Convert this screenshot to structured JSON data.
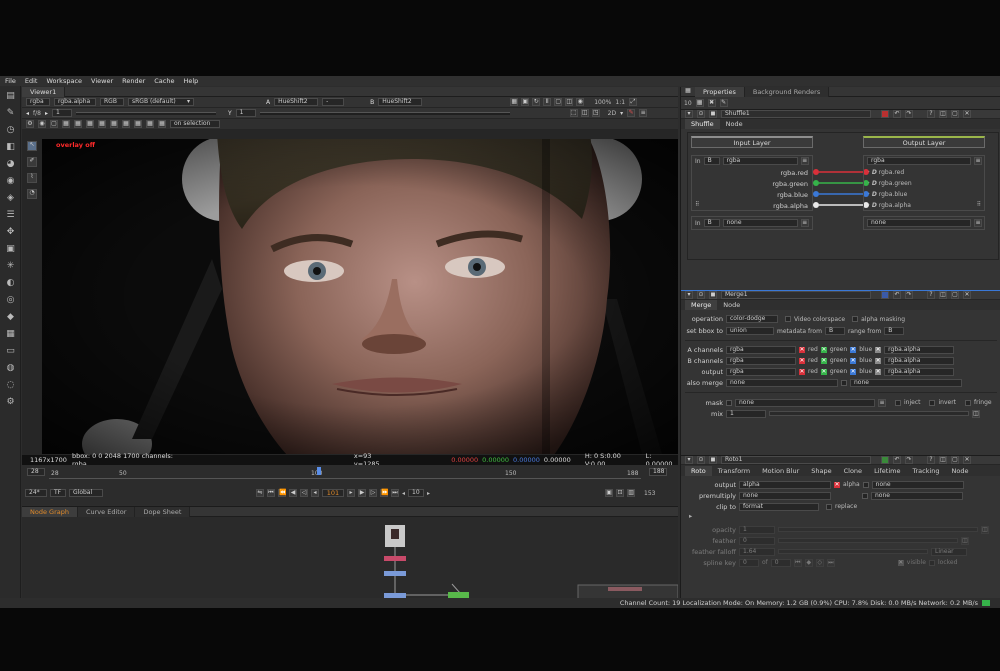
{
  "menu": [
    "File",
    "Edit",
    "Workspace",
    "Viewer",
    "Render",
    "Cache",
    "Help"
  ],
  "viewer": {
    "tab": "Viewer1",
    "channels": "rgba",
    "alpha": "rgba.alpha",
    "display": "RGB",
    "lut": "sRGB (default)",
    "input_a_label": "A",
    "input_a": "HueShift2",
    "input_b_label": "B",
    "input_b": "HueShift2",
    "zoom": "100%",
    "ratio": "1:1",
    "mode": "2D",
    "fstop": "f/8",
    "gain": "1",
    "gamma_label": "Y",
    "gamma": "1",
    "roi_mode": "on selection",
    "overlay_text": "overlay off",
    "info_res": "1167x1700",
    "info_bbox": "bbox: 0 0 2048 1700 channels: rgba",
    "info_xy": "x=93 y=1285",
    "info_r": "0.00000",
    "info_g": "0.00000",
    "info_b": "0.00000",
    "info_a": "0.00000",
    "info_hsv": "H: 0 S:0.00 V:0.00",
    "info_l": "L: 0.00000"
  },
  "timeline": {
    "ticks": [
      "28",
      "50",
      "100",
      "150",
      "188"
    ],
    "start": "28",
    "end": "188",
    "fps": "24*",
    "tf": "TF",
    "scope": "Global",
    "current_frame": "101",
    "step": "10",
    "frame_count": "153",
    "current_frame_fraction": 0.456
  },
  "lower_tabs": [
    "Node Graph",
    "Curve Editor",
    "Dope Sheet"
  ],
  "properties": {
    "tabs": [
      "Properties",
      "Background Renders"
    ],
    "max_panels": "10",
    "shuffle": {
      "name": "Shuffle1",
      "tabs": [
        "Shuffle",
        "Node"
      ],
      "input_layer": "Input Layer",
      "output_layer": "Output Layer",
      "in_label": "In",
      "in_b": "B",
      "in_layer": "rgba",
      "out_layer": "rgba",
      "in_channels": [
        "rgba.red",
        "rgba.green",
        "rgba.blue",
        "rgba.alpha"
      ],
      "out_channels": [
        "rgba.red",
        "rgba.green",
        "rgba.blue",
        "rgba.alpha"
      ],
      "in2_label": "In",
      "in2_b": "B",
      "in2_layer": "none",
      "out2_layer": "none"
    },
    "merge": {
      "name": "Merge1",
      "tabs": [
        "Merge",
        "Node"
      ],
      "operation_label": "operation",
      "operation": "color-dodge",
      "video_colorspace": "Video colorspace",
      "alpha_masking": "alpha masking",
      "bbox_label": "set bbox to",
      "bbox": "union",
      "metadata_label": "metadata from",
      "metadata": "B",
      "range_label": "range from",
      "range": "B",
      "a_channels_label": "A channels",
      "b_channels_label": "B channels",
      "output_label": "output",
      "channel_value": "rgba",
      "red": "red",
      "green": "green",
      "blue": "blue",
      "alpha_value": "rgba.alpha",
      "also_merge_label": "also merge",
      "also_merge": "none",
      "also_merge2": "none",
      "mask_label": "mask",
      "mask": "none",
      "inject": "inject",
      "invert": "invert",
      "fringe": "fringe",
      "mix_label": "mix",
      "mix": "1"
    },
    "roto": {
      "name": "Roto1",
      "tabs": [
        "Roto",
        "Transform",
        "Motion Blur",
        "Shape",
        "Clone",
        "Lifetime",
        "Tracking",
        "Node"
      ],
      "output_label": "output",
      "output": "alpha",
      "alpha_label": "alpha",
      "output_extra": "none",
      "premultiply_label": "premultiply",
      "premultiply": "none",
      "premultiply_extra": "none",
      "clip_label": "clip to",
      "clip": "format",
      "replace": "replace",
      "opacity_label": "opacity",
      "opacity": "1",
      "feather_label": "feather",
      "feather": "0",
      "feather_falloff_label": "feather falloff",
      "feather_falloff": "1.64",
      "falloff_type": "Linear",
      "spline_key_label": "spline key",
      "spline_key": "0",
      "of_label": "of",
      "of_value": "0",
      "visible": "visible",
      "locked": "locked"
    }
  },
  "status": "Channel Count: 19  Localization Mode: On  Memory: 1.2 GB (0.9%)  CPU: 7.8%  Disk: 0.0 MB/s  Network: 0.2 MB/s",
  "colors": {
    "accent_orange": "#e08a2a",
    "red": "#d9303a",
    "green": "#36b34a",
    "blue": "#3a78d6",
    "overlay_red": "#ff2a2a"
  }
}
